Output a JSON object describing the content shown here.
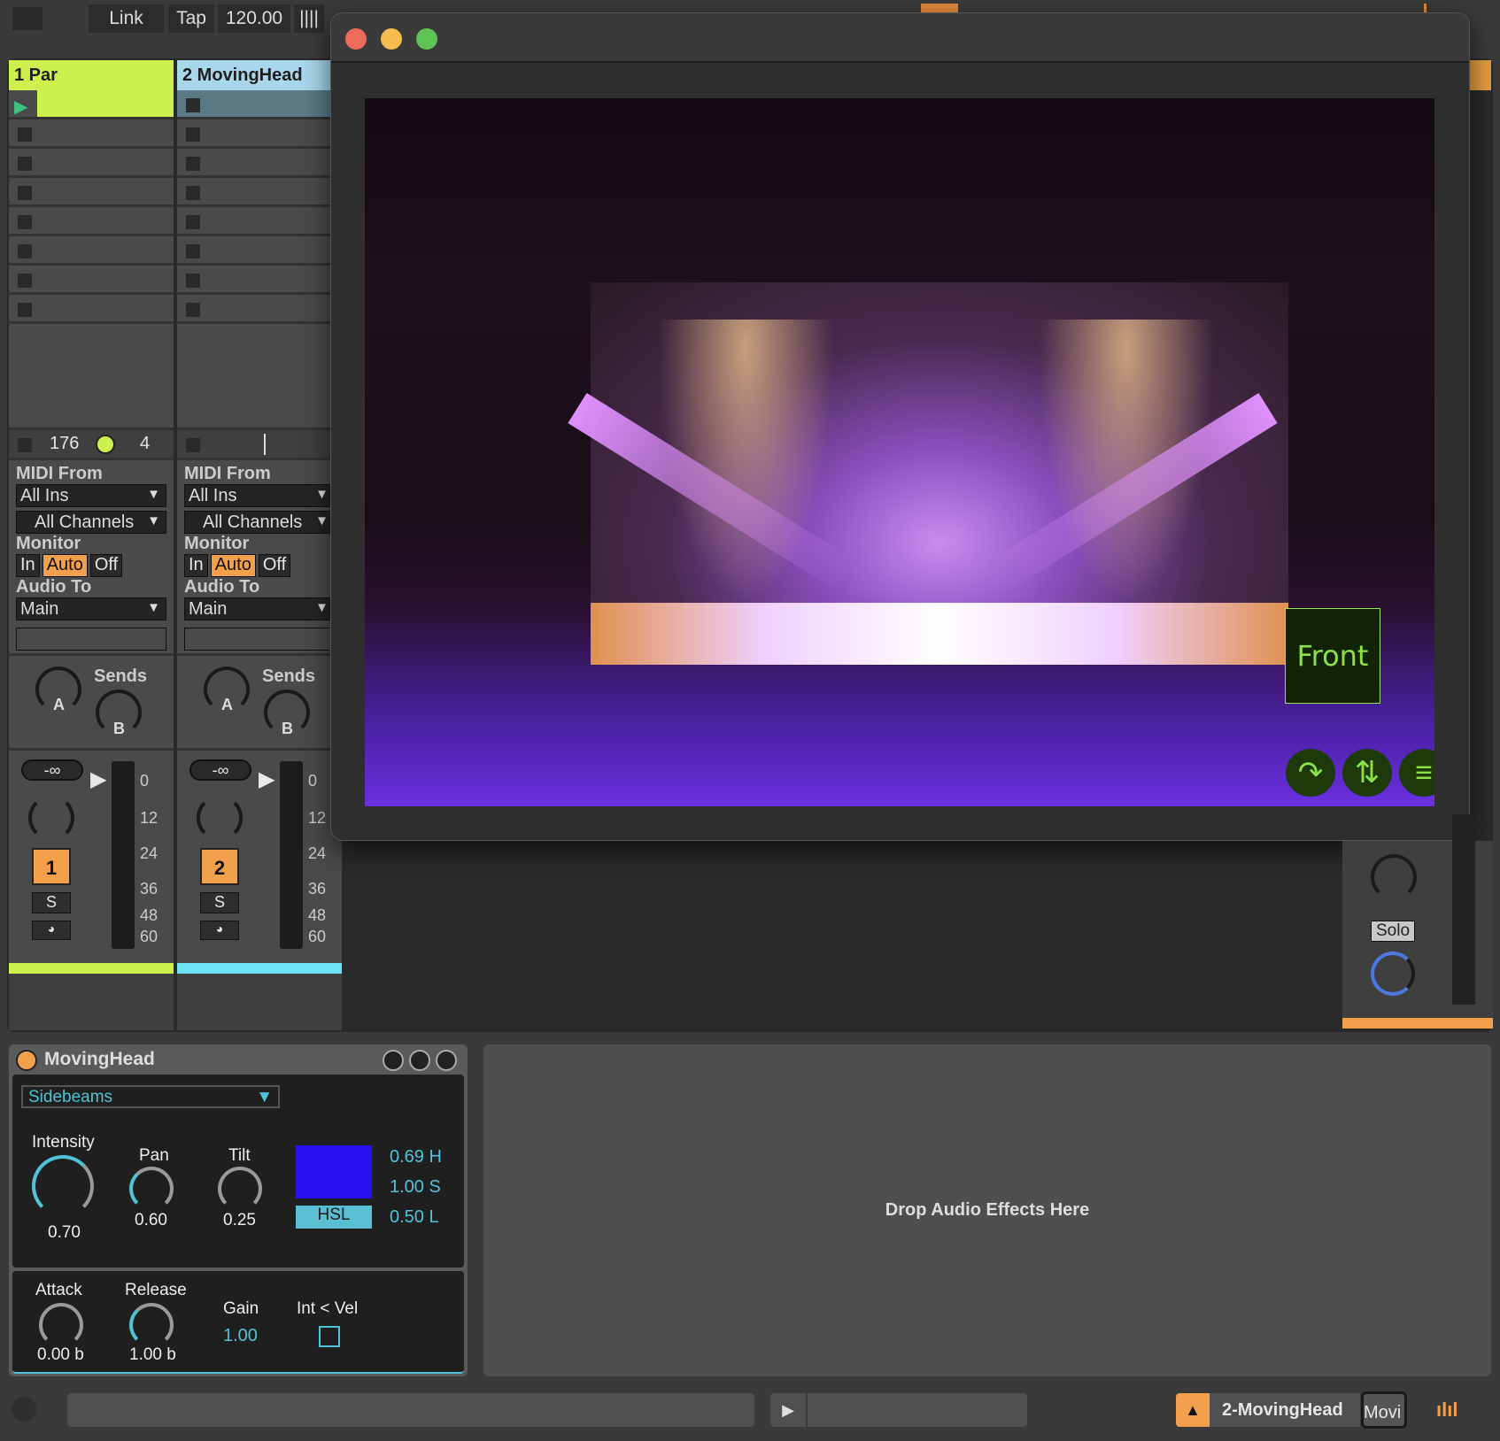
{
  "transport": {
    "link": "Link",
    "tap": "Tap",
    "tempo": "120.00"
  },
  "tracks": [
    {
      "name": "1 Par",
      "color": "#cdf04f",
      "status_count": "176",
      "status_meter": "4",
      "midi_from_label": "MIDI From",
      "midi_from": "All Ins",
      "channels": "All Channels",
      "monitor_label": "Monitor",
      "monitor": [
        "In",
        "Auto",
        "Off"
      ],
      "audio_to_label": "Audio To",
      "audio_to": "Main",
      "sends_label": "Sends",
      "send_a": "A",
      "send_b": "B",
      "volume": "-∞",
      "number": "1",
      "solo": "S",
      "scale": [
        "0",
        "12",
        "24",
        "36",
        "48",
        "60"
      ]
    },
    {
      "name": "2 MovingHead",
      "color": "#6de3f7",
      "midi_from_label": "MIDI From",
      "midi_from": "All Ins",
      "channels": "All Channels",
      "monitor_label": "Monitor",
      "monitor": [
        "In",
        "Auto",
        "Off"
      ],
      "audio_to_label": "Audio To",
      "audio_to": "Main",
      "sends_label": "Sends",
      "send_a": "A",
      "send_b": "B",
      "volume": "-∞",
      "number": "2",
      "solo": "S",
      "scale": [
        "0",
        "12",
        "24",
        "36",
        "48",
        "60"
      ]
    }
  ],
  "master": {
    "solo": "Solo"
  },
  "plugin_window": {
    "view_label": "Front",
    "icons": [
      "rotate-icon",
      "swap-icon",
      "menu-icon"
    ]
  },
  "device": {
    "title": "MovingHead",
    "preset": "Sidebeams",
    "intensity": {
      "label": "Intensity",
      "value": "0.70"
    },
    "pan": {
      "label": "Pan",
      "value": "0.60"
    },
    "tilt": {
      "label": "Tilt",
      "value": "0.25"
    },
    "color_swatch": "#2a10f0",
    "color_mode": "HSL",
    "h": "0.69 H",
    "s": "1.00 S",
    "l": "0.50 L",
    "attack": {
      "label": "Attack",
      "value": "0.00 b"
    },
    "release": {
      "label": "Release",
      "value": "1.00 b"
    },
    "gain": {
      "label": "Gain",
      "value": "1.00"
    },
    "int_vel": {
      "label": "Int < Vel",
      "checked": false
    }
  },
  "drop_area": "Drop Audio Effects Here",
  "statusbar": {
    "track_name": "2-MovingHead",
    "thumb": "Movi"
  },
  "colors": {
    "accent": "#f3a04c",
    "cyan": "#4fc4d8",
    "green": "#8ee04a"
  }
}
